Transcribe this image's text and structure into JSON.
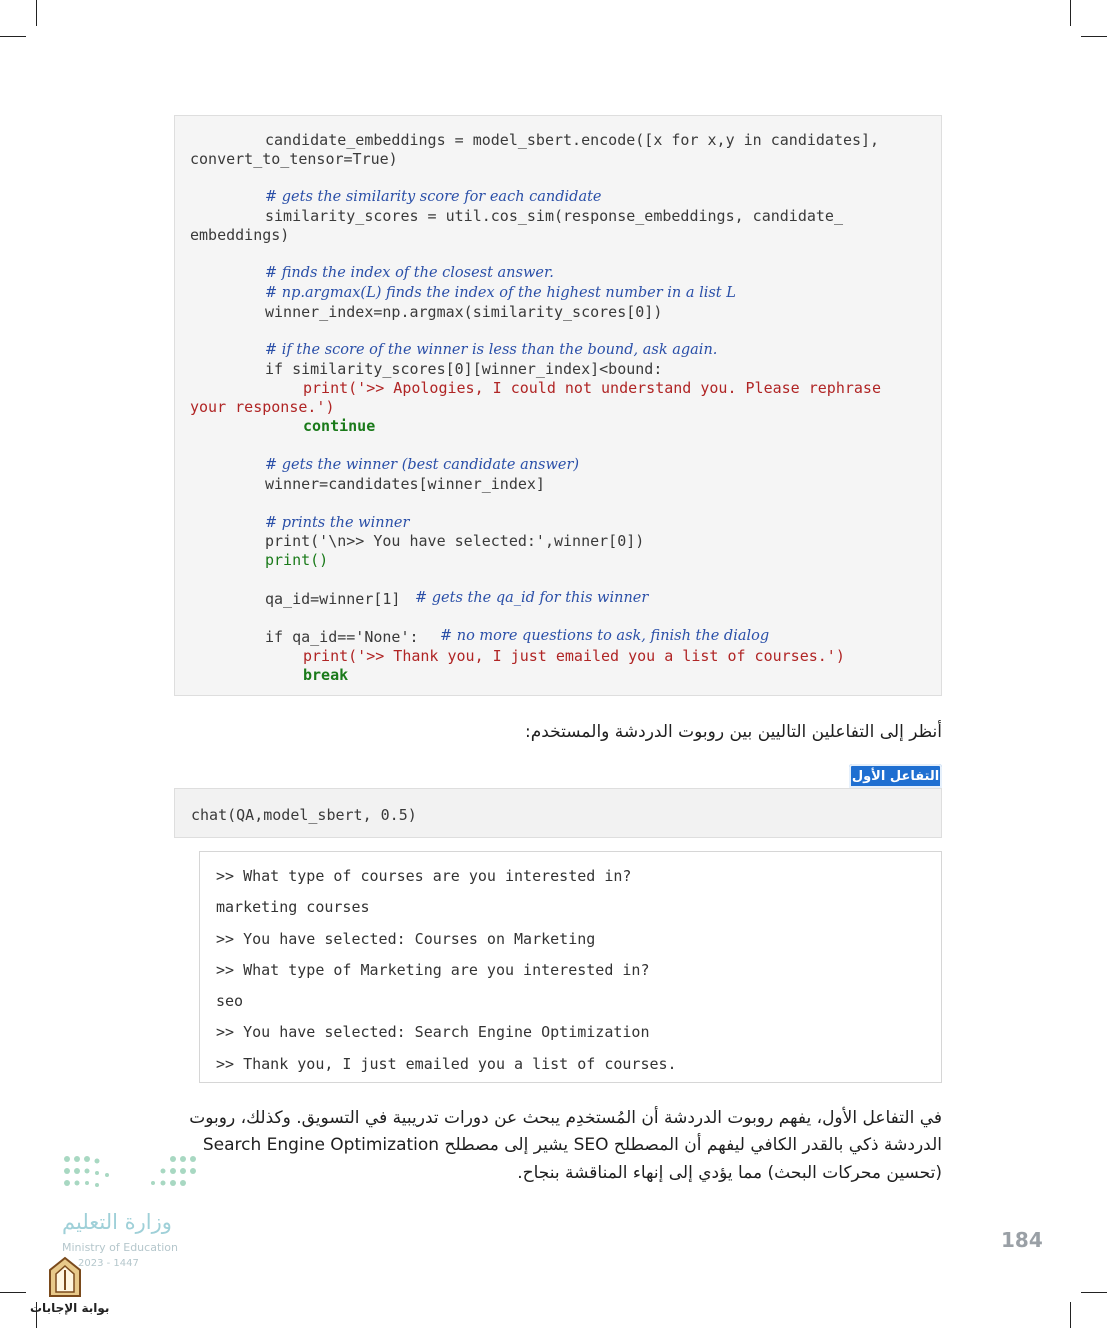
{
  "code": {
    "line_encode_1": "candidate_embeddings = model_sbert.encode([x for x,y in candidates],",
    "line_encode_2": "convert_to_tensor=True)",
    "comment_similarity": "# gets the similarity score for each candidate",
    "line_sim_1": "similarity_scores = util.cos_sim(response_embeddings, candidate_",
    "line_sim_2": "embeddings)",
    "comment_closest": "# finds the index of the closest answer.",
    "comment_argmax": "# np.argmax(L) finds the index of the highest number in a list L",
    "line_winner_index": "winner_index=np.argmax(similarity_scores[0])",
    "comment_bound": "# if the score of the winner is less than the bound, ask again.",
    "line_if_sim": "if similarity_scores[0][winner_index]<bound:",
    "line_print_apology_1": "print('>> Apologies, I could not understand you. Please rephrase",
    "line_print_apology_2": "your response.')",
    "line_continue": "continue",
    "comment_best": "# gets the winner (best candidate answer)",
    "line_winner": "winner=candidates[winner_index]",
    "comment_prints": "# prints the winner",
    "line_print_selected": "print('\\n>> You have selected:',winner[0])",
    "line_print_empty": "print()",
    "line_qa_id": "qa_id=winner[1]",
    "comment_qa_id": "# gets the qa_id for this winner",
    "line_if_qa": "if qa_id=='None':",
    "comment_qa_none": "# no more questions to ask, finish the dialog",
    "line_print_thank": "print('>> Thank you, I just emailed you a list of courses.')",
    "line_break": "break"
  },
  "heading": "أنظر إلى التفاعلين التاليين بين روبوت الدردشة والمستخدم:",
  "badge": "التفاعل الأول",
  "call": "chat(QA,model_sbert, 0.5)",
  "output": [
    ">> What type of courses are you interested in?",
    "marketing courses",
    ">> You have selected: Courses on Marketing",
    ">> What type of Marketing are you interested in?",
    "seo",
    ">> You have selected: Search Engine Optimization",
    ">> Thank you, I just emailed you a list of courses."
  ],
  "paragraph": {
    "line1": "في التفاعل الأول، يفهم روبوت الدردشة أن المُستخدِم يبحث عن دورات تدريبية في التسويق. وكذلك، روبوت",
    "line2_ar": "الدردشة ذكي بالقدر الكافي ليفهم أن المصطلح SEO يشير إلى مصطلح",
    "line2_en": "Search Engine Optimization",
    "line3": "(تحسين محركات البحث) مما يؤدي إلى إنهاء المناقشة بنجاح."
  },
  "page_number": "184",
  "footer": {
    "ministry_ar": "وزارة التعليم",
    "ministry_en": "Ministry of Education",
    "year": "2023 - 1447",
    "logo_label": "بوابة الإجابات"
  }
}
